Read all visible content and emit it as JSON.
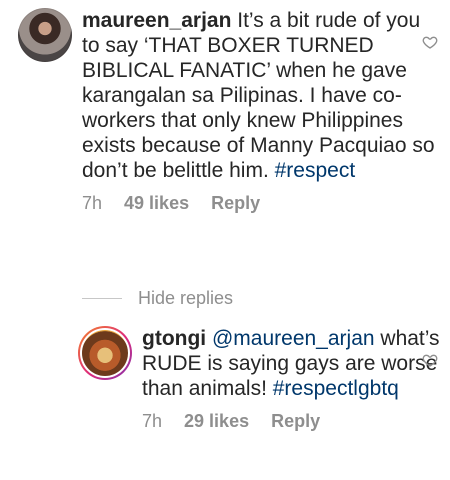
{
  "comment": {
    "username": "maureen_arjan",
    "text": " It’s a bit rude of you to say ‘THAT BOXER TURNED BIBLICAL FANATIC’ when he gave karangalan sa Pilipinas. I have co-workers that only knew  Philippines exists because of Manny Pacquiao so don’t be belittle him. ",
    "hashtag": "#respect",
    "time": "7h",
    "likes": "49 likes",
    "reply_label": "Reply"
  },
  "hide_replies": "Hide replies",
  "reply": {
    "username": "gtongi",
    "mention": "@maureen_arjan",
    "text": " what’s RUDE is saying gays are worse than animals! ",
    "hashtag": "#respectlgbtq",
    "time": "7h",
    "likes": "29 likes",
    "reply_label": "Reply"
  },
  "icons": {
    "like": "heart-outline-icon",
    "color_icon": "#8e8e8e",
    "color_link": "#00376b"
  }
}
